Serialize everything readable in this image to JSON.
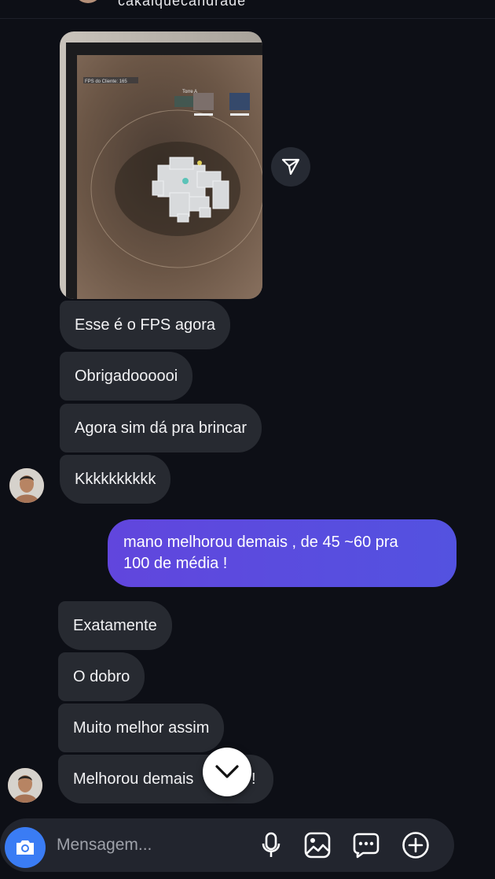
{
  "header": {
    "username": "cakaiquecandrade"
  },
  "messages": [
    {
      "id": "m1",
      "text": "Esse é o  FPS agora",
      "direction": "received"
    },
    {
      "id": "m2",
      "text": "Obrigadoooooi",
      "direction": "received"
    },
    {
      "id": "m3",
      "text": "Agora sim dá pra brincar",
      "direction": "received"
    },
    {
      "id": "m4",
      "text": "Kkkkkkkkkk",
      "direction": "received"
    },
    {
      "id": "m5",
      "lines": [
        "mano melhorou demais , de 45 ~60  pra",
        "100 de média !"
      ],
      "direction": "sent"
    },
    {
      "id": "m6",
      "text": "Exatamente",
      "direction": "received"
    },
    {
      "id": "m7",
      "text": "O dobro",
      "direction": "received"
    },
    {
      "id": "m8",
      "text": "Muito melhor assim",
      "direction": "received"
    },
    {
      "id": "m9",
      "text": "Melhorou demais",
      "suffix": "!",
      "direction": "received"
    }
  ],
  "photo": {
    "overlay_fps": "FPS do Cliente: 165",
    "overlay_team": "Torre A"
  },
  "composer": {
    "placeholder": "Mensagem..."
  },
  "colors": {
    "background": "#0d0f16",
    "received_bubble": "#272a31",
    "sent_bubble": "#5a4bd9",
    "camera_button": "#3a7cf4"
  },
  "icons": [
    "share-icon",
    "chevron-down-icon",
    "camera-icon",
    "microphone-icon",
    "gallery-icon",
    "sticker-icon",
    "plus-circle-icon"
  ]
}
